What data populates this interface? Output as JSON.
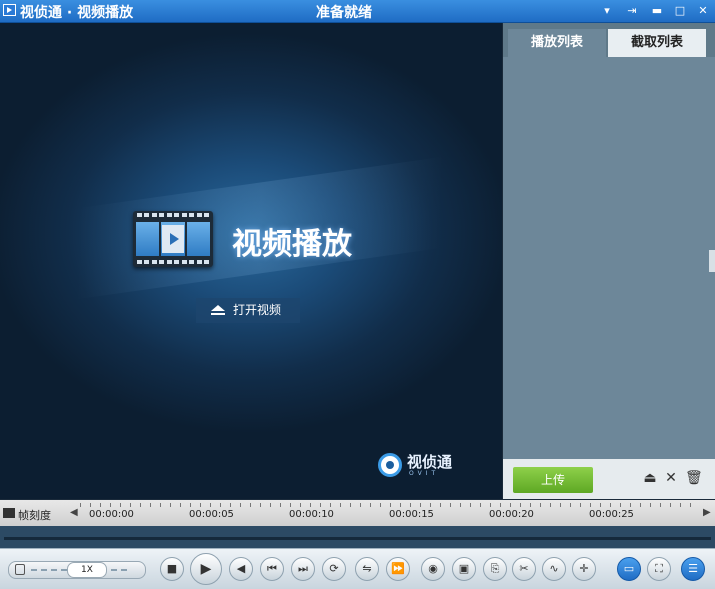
{
  "window": {
    "app_title": "视侦通 · 视频播放",
    "status": "准备就绪"
  },
  "video": {
    "title": "视频播放",
    "open_label": "打开视频",
    "logo_text": "视侦通",
    "logo_sub": "OVIT"
  },
  "panel": {
    "tabs": [
      {
        "label": "播放列表",
        "active": true
      },
      {
        "label": "截取列表",
        "active": false
      }
    ],
    "upload_label": "上传"
  },
  "timeline": {
    "label": "帧刻度",
    "times": [
      "00:00:00",
      "00:00:05",
      "00:00:10",
      "00:00:15",
      "00:00:20",
      "00:00:25"
    ]
  },
  "controls": {
    "speed": "1X"
  },
  "colors": {
    "titlebar": "#1f6cc4",
    "panel": "#6d8799",
    "upload": "#6cb42c"
  }
}
